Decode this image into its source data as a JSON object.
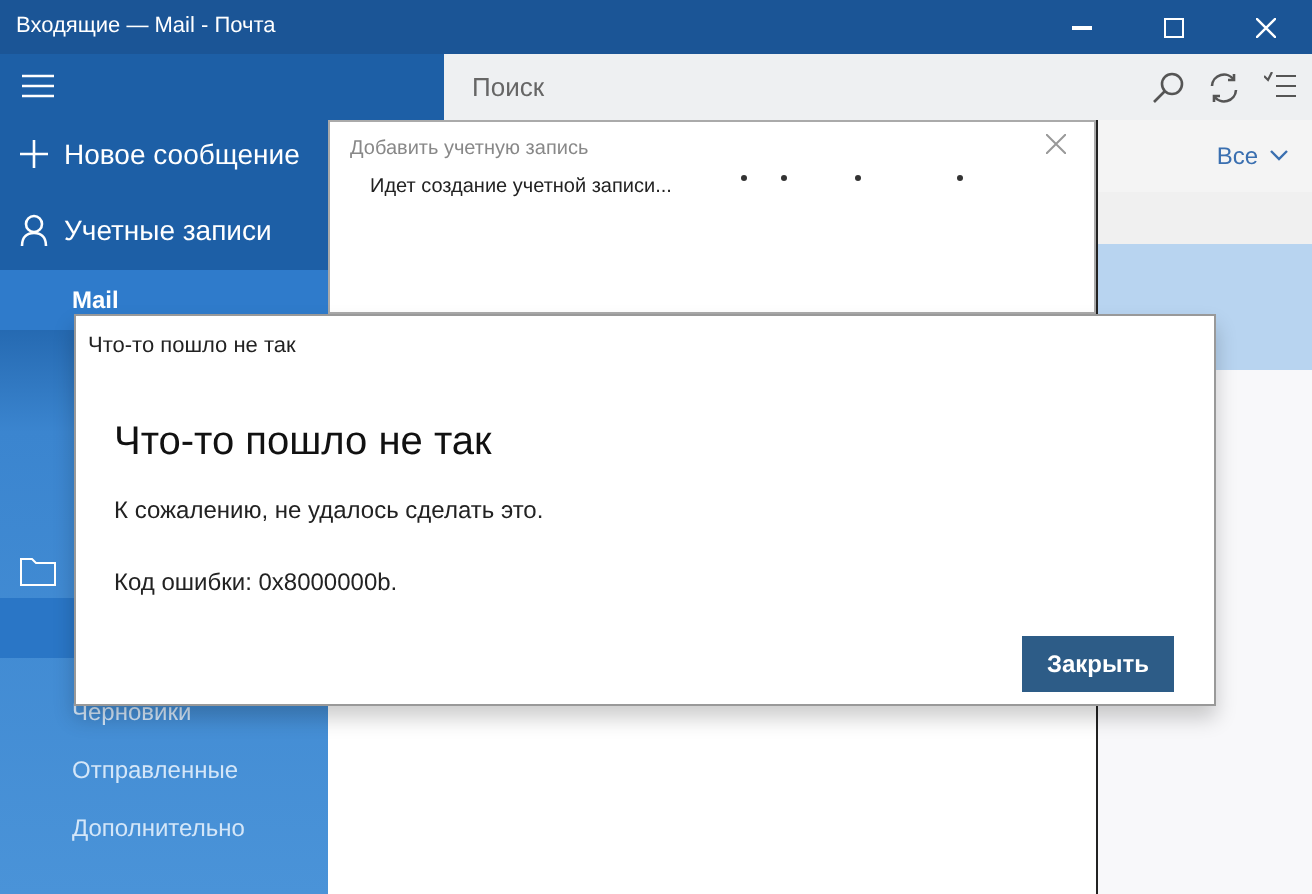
{
  "window": {
    "title": "Входящие — Mail - Почта"
  },
  "sidebar": {
    "new_message": "Новое сообщение",
    "accounts": "Учетные записи",
    "account": {
      "label": "Mail",
      "selected": true
    },
    "folders": [
      {
        "label": "Черновики",
        "selected": false
      },
      {
        "label": "Отправленные",
        "selected": false
      },
      {
        "label": "Дополнительно",
        "selected": false
      }
    ]
  },
  "search": {
    "placeholder": "Поиск"
  },
  "filter": {
    "label": "Все"
  },
  "add_account_dialog": {
    "title": "Добавить учетную запись",
    "message": "Идет создание учетной записи..."
  },
  "error_dialog": {
    "caption": "Что-то пошло не так",
    "heading": "Что-то пошло не так",
    "message": "К сожалению, не удалось сделать это.",
    "error_code": "Код ошибки: 0x8000000b.",
    "button": "Закрыть"
  }
}
